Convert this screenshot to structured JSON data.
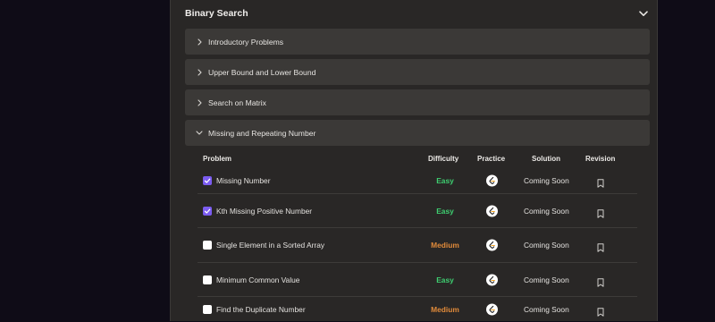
{
  "section": {
    "title": "Binary Search",
    "expand_icon": "chevron-down-icon"
  },
  "accordions": [
    {
      "label": "Introductory Problems",
      "expanded": false
    },
    {
      "label": "Upper Bound and Lower Bound",
      "expanded": false
    },
    {
      "label": "Search on Matrix",
      "expanded": false
    },
    {
      "label": "Missing and Repeating Number",
      "expanded": true
    }
  ],
  "table": {
    "headers": {
      "problem": "Problem",
      "difficulty": "Difficulty",
      "practice": "Practice",
      "solution": "Solution",
      "revision": "Revision"
    },
    "rows": [
      {
        "name": "Missing Number",
        "difficulty": "Easy",
        "solution": "Coming Soon",
        "checked": true
      },
      {
        "name": "Kth Missing Positive Number",
        "difficulty": "Easy",
        "solution": "Coming Soon",
        "checked": true
      },
      {
        "name": "Single Element in a Sorted Array",
        "difficulty": "Medium",
        "solution": "Coming Soon",
        "checked": false
      },
      {
        "name": "Minimum Common Value",
        "difficulty": "Easy",
        "solution": "Coming Soon",
        "checked": false
      },
      {
        "name": "Find the Duplicate Number",
        "difficulty": "Medium",
        "solution": "Coming Soon",
        "checked": false
      }
    ]
  },
  "colors": {
    "page_bg": "#0f0c17",
    "panel_bg": "#292726",
    "accordion_bg": "#3b3937",
    "checkbox_checked": "#7b5cf0",
    "easy": "#3ecf71",
    "medium": "#e08a3a"
  },
  "icons": {
    "practice": "leetcode-icon",
    "revision": "bookmark-icon",
    "checked": "checkmark-icon"
  }
}
